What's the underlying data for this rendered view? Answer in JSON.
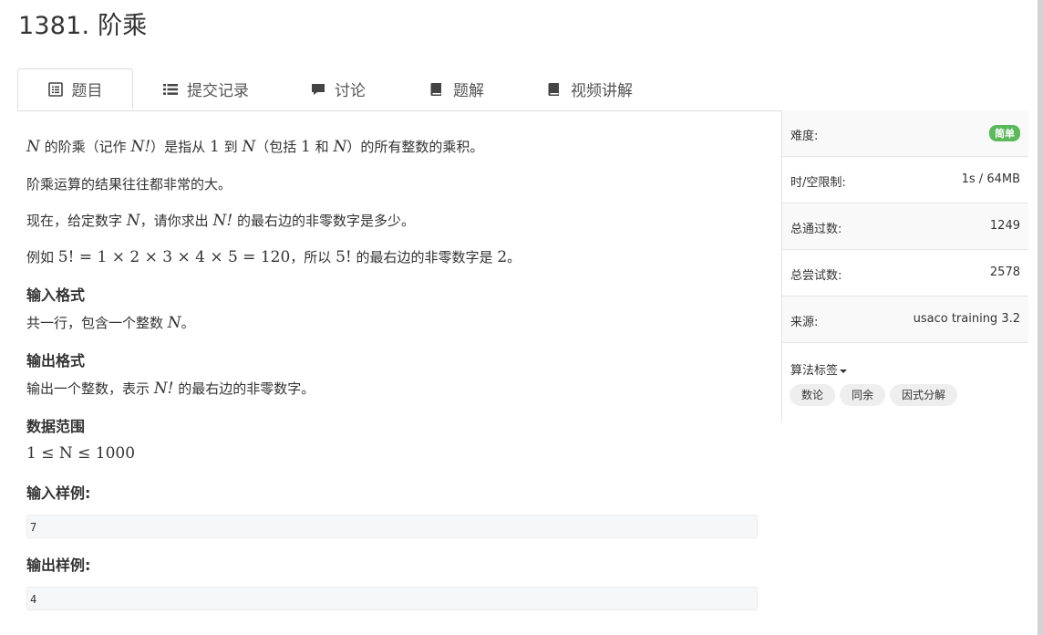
{
  "page": {
    "title": "1381. 阶乘"
  },
  "tabs": [
    {
      "label": "题目",
      "icon": "list-alt-icon",
      "active": true
    },
    {
      "label": "提交记录",
      "icon": "list-icon"
    },
    {
      "label": "讨论",
      "icon": "comment-icon"
    },
    {
      "label": "题解",
      "icon": "book-icon"
    },
    {
      "label": "视频讲解",
      "icon": "book-icon"
    }
  ],
  "problem": {
    "desc1": {
      "a": "的阶乘（记作",
      "b": "）是指从",
      "c": "到",
      "d": "（包括",
      "e": "和",
      "f": "）的所有整数的乘积。",
      "var_n": "N",
      "n_fact": "N!",
      "one": "1"
    },
    "desc2": "阶乘运算的结果往往都非常的大。",
    "desc3": {
      "a": "现在，给定数字",
      "b": "，请你求出",
      "c": "的最右边的非零数字是多少。"
    },
    "desc4": {
      "a": "例如",
      "expr": "5! = 1 × 2 × 3 × 4 × 5 = 120",
      "b": "，所以",
      "c": "的最右边的非零数字是",
      "five_fact": "5!",
      "ans": "2",
      "d": "。"
    },
    "input_format_title": "输入格式",
    "input_format": {
      "a": "共一行，包含一个整数",
      "b": "。"
    },
    "output_format_title": "输出格式",
    "output_format": {
      "a": "输出一个整数，表示",
      "b": "的最右边的非零数字。"
    },
    "range_title": "数据范围",
    "range": "1 ≤ N ≤ 1000",
    "sample_input_title": "输入样例:",
    "sample_input": "7",
    "sample_output_title": "输出样例:",
    "sample_output": "4"
  },
  "sidebar": {
    "difficulty_label": "难度:",
    "difficulty_value": "简单",
    "limit_label": "时/空限制:",
    "limit_value": "1s / 64MB",
    "accepted_label": "总通过数:",
    "accepted_value": "1249",
    "attempts_label": "总尝试数:",
    "attempts_value": "2578",
    "source_label": "来源:",
    "source_value": "usaco training 3.2",
    "tags_label": "算法标签",
    "tags": [
      "数论",
      "同余",
      "因式分解"
    ]
  },
  "colors": {
    "badge_green": "#5cb85c",
    "border": "#dddddd"
  }
}
